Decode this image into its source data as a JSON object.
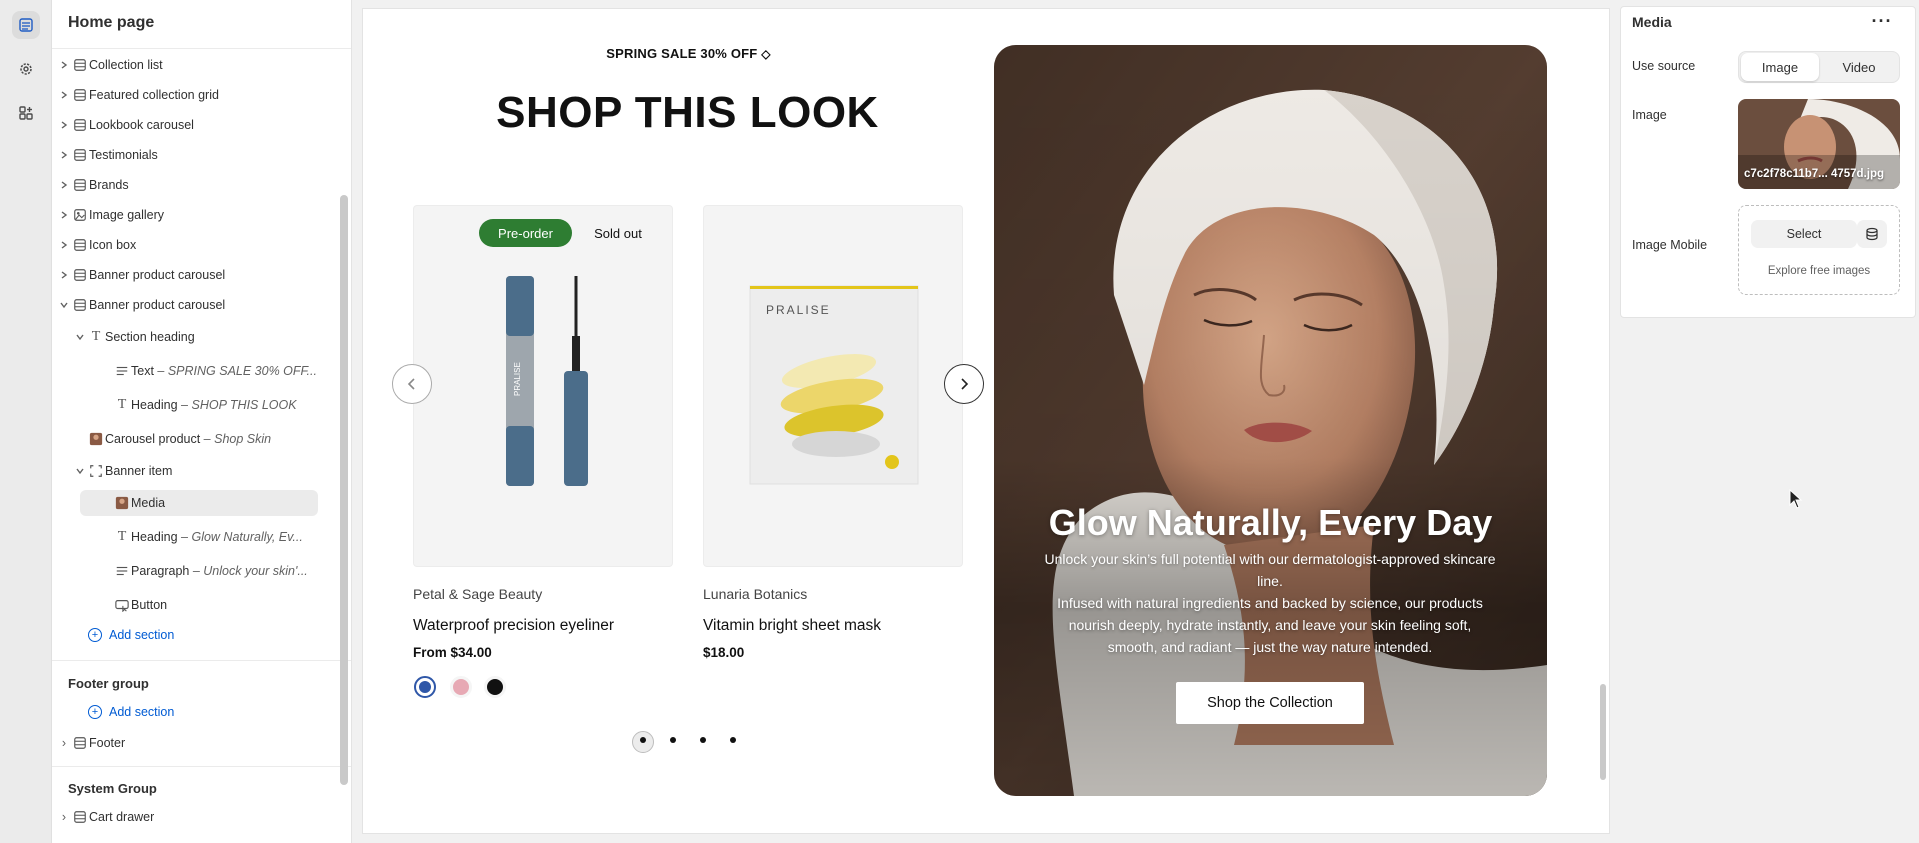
{
  "sidebar": {
    "title": "Home page",
    "items": [
      {
        "label": "Collection list",
        "note": ""
      },
      {
        "label": "Featured collection grid",
        "note": ""
      },
      {
        "label": "Lookbook carousel",
        "note": ""
      },
      {
        "label": "Testimonials",
        "note": ""
      },
      {
        "label": "Brands",
        "note": ""
      },
      {
        "label": "Image gallery",
        "note": ""
      },
      {
        "label": "Icon box",
        "note": ""
      },
      {
        "label": "Banner product carousel",
        "note": ""
      },
      {
        "label": "Banner product carousel",
        "note": ""
      },
      {
        "label": "Section heading",
        "note": ""
      },
      {
        "label": "Text",
        "note": "SPRING SALE 30% OFF..."
      },
      {
        "label": "Heading",
        "note": "SHOP THIS LOOK"
      },
      {
        "label": "Carousel product",
        "note": "Shop Skin"
      },
      {
        "label": "Banner item",
        "note": ""
      },
      {
        "label": "Media",
        "note": ""
      },
      {
        "label": "Heading",
        "note": "Glow Naturally, Ev..."
      },
      {
        "label": "Paragraph",
        "note": "Unlock your skin'..."
      },
      {
        "label": "Button",
        "note": ""
      }
    ],
    "add_section": "Add section",
    "footer_group": "Footer group",
    "footer_add_section": "Add section",
    "footer_item": "Footer",
    "system_group": "System Group",
    "cart_drawer": "Cart drawer"
  },
  "canvas": {
    "promo": "SPRING SALE 30% OFF",
    "heading": "SHOP THIS LOOK",
    "products": [
      {
        "badges": [
          "Pre-order",
          "Sold out"
        ],
        "vendor": "Petal & Sage Beauty",
        "name": "Waterproof precision eyeliner",
        "price": "From $34.00",
        "image_brand": "PRALISE"
      },
      {
        "badges": [],
        "vendor": "Lunaria Botanics",
        "name": "Vitamin bright sheet mask",
        "price": "$18.00",
        "image_brand": "PRALISE"
      }
    ],
    "swatches": [
      "#2f57a8",
      "#e7a9b4",
      "#111111"
    ],
    "banner": {
      "heading": "Glow Naturally, Every Day",
      "paragraph1": "Unlock your skin’s full potential with our dermatologist-approved skincare line.",
      "paragraph2": "Infused with natural ingredients and backed by science, our products nourish deeply, hydrate instantly, and leave your skin feeling soft, smooth, and radiant — just the way nature intended.",
      "button": "Shop the Collection"
    },
    "pagination_dots": 4
  },
  "panel": {
    "title": "Media",
    "use_source_label": "Use source",
    "source_options": [
      "Image",
      "Video"
    ],
    "source_selected": "Image",
    "image_label": "Image",
    "image_filename": "c7c2f78c11b7... 4757d.jpg",
    "image_mobile_label": "Image Mobile",
    "select_button": "Select",
    "explore_link": "Explore free images"
  },
  "colors": {
    "accent_blue": "#005bd3",
    "preorder_green": "#2e7d32"
  }
}
